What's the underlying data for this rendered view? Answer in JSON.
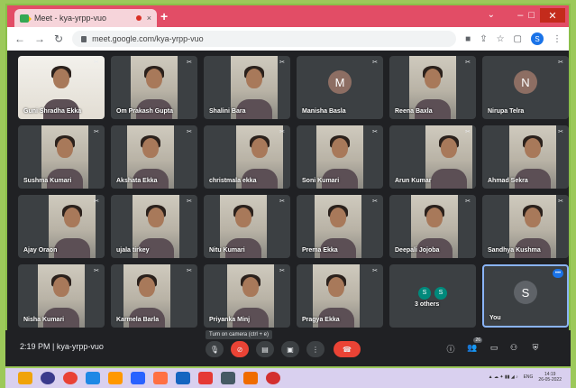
{
  "browser": {
    "tab_title": "Meet - kya-yrpp-vuo",
    "tab_close": "×",
    "new_tab": "+",
    "url": "meet.google.com/kya-yrpp-vuo",
    "profile_initial": "S",
    "window_controls": [
      "–",
      "□",
      "✕"
    ]
  },
  "colors": {
    "avatar_m": "#8d6e63",
    "avatar_n": "#8d6e63",
    "others_s1": "#00897b",
    "others_s2": "#00897b",
    "you_avatar": "#5f6368",
    "accent_blue": "#8ab4f8",
    "end_call_red": "#ea4335"
  },
  "participants": [
    {
      "name": "Guni Shradha Ekka"
    },
    {
      "name": "Om Prakash Gupta"
    },
    {
      "name": "Shalini Bara"
    },
    {
      "name": "Manisha Basla",
      "avatar": "M"
    },
    {
      "name": "Reena Baxla"
    },
    {
      "name": "Nirupa Telra",
      "avatar": "N"
    },
    {
      "name": "Sushma Kumari"
    },
    {
      "name": "Akshata Ekka"
    },
    {
      "name": "christmala ekka"
    },
    {
      "name": "Soni Kumari"
    },
    {
      "name": "Arun Kumar"
    },
    {
      "name": "Ahmad Sekra"
    },
    {
      "name": "Ajay Oraon"
    },
    {
      "name": "ujala tirkey"
    },
    {
      "name": "Nitu Kumari"
    },
    {
      "name": "Prema Ekka"
    },
    {
      "name": "Deepali Jojoba"
    },
    {
      "name": "Sandhya Kushma"
    },
    {
      "name": "Nisha Kumari"
    },
    {
      "name": "Karmela Barla"
    },
    {
      "name": "Priyanka Minj"
    },
    {
      "name": "Pragya Ekka"
    }
  ],
  "others_tile": {
    "label": "3 others",
    "initials": [
      "S",
      "S"
    ]
  },
  "you_tile": {
    "label": "You",
    "avatar": "S"
  },
  "controls": {
    "time": "2:19 PM",
    "separator": "|",
    "meeting_code": "kya-yrpp-vuo",
    "tooltip": "Turn on camera (ctrl + e)",
    "people_count": "26",
    "icons": [
      "mic-icon",
      "camera-off-icon",
      "captions-icon",
      "present-icon",
      "more-icon",
      "end-call-icon"
    ]
  },
  "taskbar": {
    "lang": "ENG",
    "time": "14:19",
    "date": "26-05-2022"
  }
}
